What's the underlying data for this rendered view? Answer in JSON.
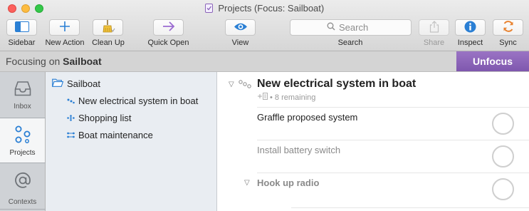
{
  "window": {
    "title": "Projects (Focus: Sailboat)"
  },
  "toolbar": {
    "sidebar_label": "Sidebar",
    "new_action_label": "New Action",
    "clean_up_label": "Clean Up",
    "quick_open_label": "Quick Open",
    "view_label": "View",
    "search_label": "Search",
    "search_placeholder": "Search",
    "share_label": "Share",
    "inspect_label": "Inspect",
    "sync_label": "Sync"
  },
  "focus_bar": {
    "prefix": "Focusing on",
    "target": "Sailboat",
    "unfocus_label": "Unfocus"
  },
  "perspectives": [
    {
      "label": "Inbox",
      "icon": "inbox-icon",
      "selected": false
    },
    {
      "label": "Projects",
      "icon": "projects-icon",
      "selected": true
    },
    {
      "label": "Contexts",
      "icon": "contexts-icon",
      "selected": false
    }
  ],
  "sidebar": {
    "folder": "Sailboat",
    "projects": [
      {
        "label": "New electrical system in boat",
        "icon": "sequential-project-icon"
      },
      {
        "label": "Shopping list",
        "icon": "single-actions-icon"
      },
      {
        "label": "Boat maintenance",
        "icon": "parallel-project-icon"
      }
    ]
  },
  "outline": {
    "project_title": "New electrical system in boat",
    "project_note": "• 8 remaining",
    "actions": [
      {
        "label": "Graffle proposed system",
        "style": "available"
      },
      {
        "label": "Install battery switch",
        "style": "remaining"
      },
      {
        "label": "Hook up radio",
        "style": "group"
      }
    ]
  },
  "colors": {
    "unfocus_bg": "#8b63b8",
    "accent_blue": "#2a7fd4",
    "sync_orange": "#e8822f"
  }
}
